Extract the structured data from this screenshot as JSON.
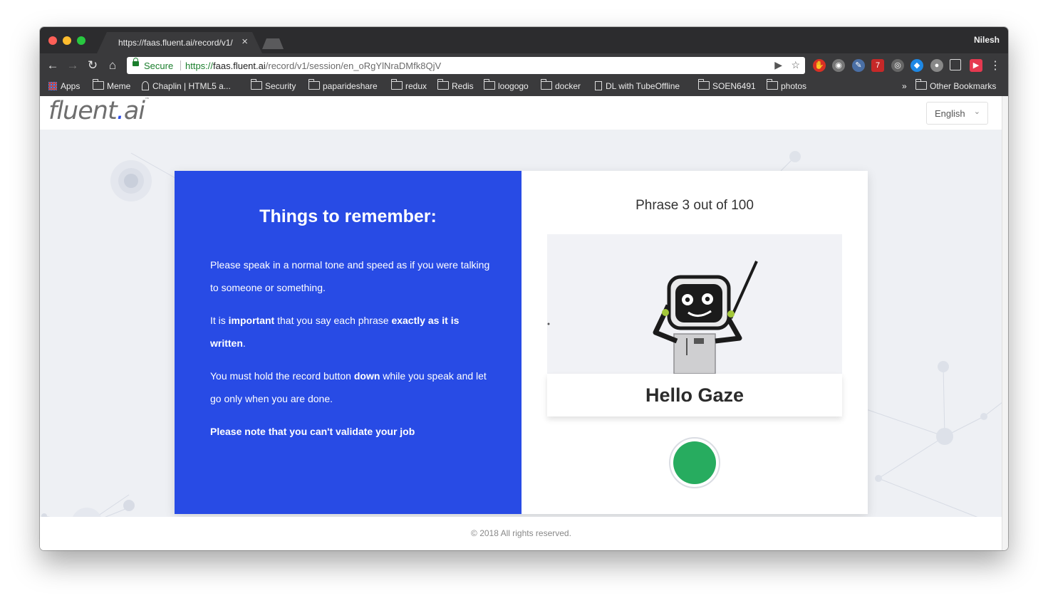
{
  "browser": {
    "tab_title": "https://faas.fluent.ai/record/v1/",
    "tab_close": "×",
    "profile_name": "Nilesh",
    "secure_label": "Secure",
    "url_scheme": "https://",
    "url_host": "faas.fluent.ai",
    "url_path": "/record/v1/session/en_oRgYlNraDMfk8QjV",
    "bookmarks": {
      "apps": "Apps",
      "meme": "Meme",
      "chaplin": "Chaplin | HTML5 a...",
      "security": "Security",
      "paparideshare": "paparideshare",
      "redux": "redux",
      "redis": "Redis",
      "loogogo": "loogogo",
      "docker": "docker",
      "dl": "DL with TubeOffline",
      "soen": "SOEN6491",
      "photos": "photos",
      "overflow": "»",
      "other": "Other Bookmarks"
    },
    "icon_names": [
      "back-arrow-icon",
      "forward-arrow-icon",
      "reload-icon",
      "home-icon",
      "lock-icon",
      "camera-icon",
      "star-icon",
      "menu-icon"
    ]
  },
  "site": {
    "logo_main": "fluent",
    "logo_dot": ".",
    "logo_tail": "ai",
    "logo_tm": "™",
    "language": "English",
    "brand_blue": "#284be5",
    "record_green": "#27ac5f"
  },
  "instructions": {
    "title": "Things to remember:",
    "p1": "Please speak in a normal tone and speed as if you were talking to someone or something.",
    "p2_a": "It is ",
    "p2_b": "important",
    "p2_c": " that you say each phrase ",
    "p2_d": "exactly as it is written",
    "p2_e": ".",
    "p3_a": "You must hold the record button ",
    "p3_b": "down",
    "p3_c": " while you speak and let go only when you are done.",
    "p4": "Please note that you can't validate your job"
  },
  "recorder": {
    "progress": "Phrase 3 out of 100",
    "phrase": "Hello Gaze"
  },
  "footer": {
    "copyright": "© 2018 All rights reserved."
  }
}
